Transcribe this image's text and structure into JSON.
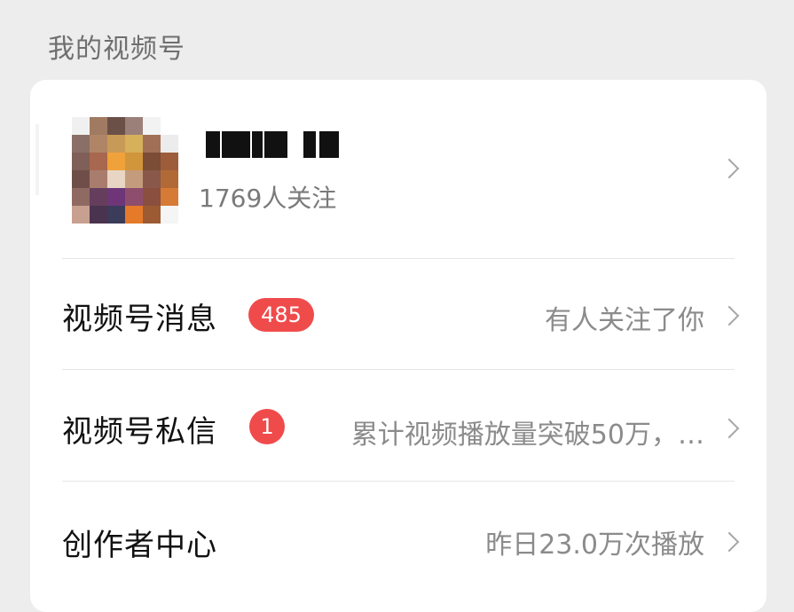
{
  "section": {
    "title": "我的视频号"
  },
  "profile": {
    "followers": "1769人关注"
  },
  "rows": [
    {
      "title": "视频号消息",
      "badge": "485",
      "subtitle": "有人关注了你"
    },
    {
      "title": "视频号私信",
      "badge": "1",
      "subtitle": "累计视频播放量突破50万，…"
    },
    {
      "title": "创作者中心",
      "subtitle": "昨日23.0万次播放"
    }
  ],
  "colors": {
    "badge": "#f04b4b",
    "background": "#ededed",
    "card": "#ffffff"
  },
  "icons": {
    "chevron": "chevron-right-icon"
  }
}
